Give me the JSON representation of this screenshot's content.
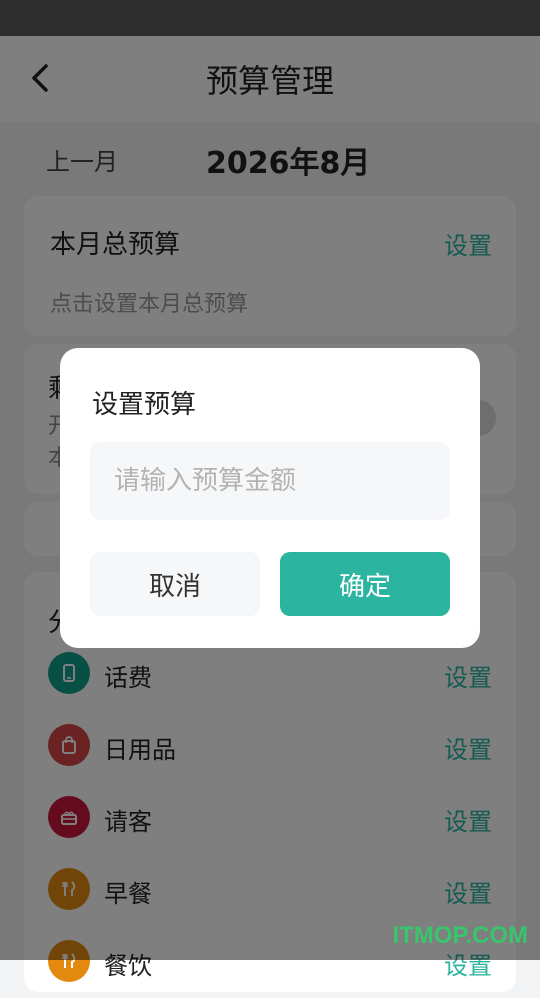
{
  "header": {
    "title": "预算管理"
  },
  "month": {
    "prev_label": "上一月",
    "current": "2026年8月"
  },
  "total_budget": {
    "label": "本月总预算",
    "set_label": "设置",
    "hint": "点击设置本月总预算"
  },
  "partial_card": {
    "line1": "剩",
    "line2": "开",
    "line3": "本"
  },
  "categories_header": "分",
  "categories": [
    {
      "name": "话费",
      "set_label": "设置",
      "color": "#119e8a",
      "icon": "phone-icon"
    },
    {
      "name": "日用品",
      "set_label": "设置",
      "color": "#d64545",
      "icon": "bag-icon"
    },
    {
      "name": "请客",
      "set_label": "设置",
      "color": "#c9183d",
      "icon": "gift-icon"
    },
    {
      "name": "早餐",
      "set_label": "设置",
      "color": "#e38a0e",
      "icon": "fork-knife-icon"
    },
    {
      "name": "餐饮",
      "set_label": "设置",
      "color": "#e38a0e",
      "icon": "fork-knife-icon"
    }
  ],
  "dialog": {
    "title": "设置预算",
    "input_placeholder": "请输入预算金额",
    "cancel_label": "取消",
    "confirm_label": "确定"
  },
  "watermark": "ITMOP.COM"
}
